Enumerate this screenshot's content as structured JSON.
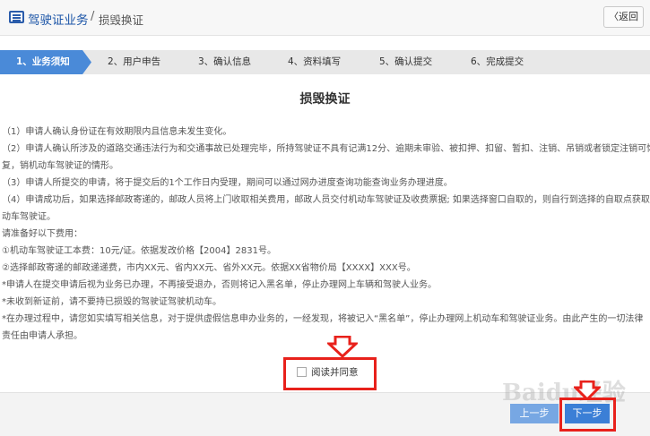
{
  "header": {
    "title": "驾驶证业务",
    "separator": "/",
    "breadcrumb": "损毁换证",
    "back_label": "〈返回"
  },
  "steps": [
    {
      "label": "1、业务须知",
      "active": true
    },
    {
      "label": "2、用户申告",
      "active": false
    },
    {
      "label": "3、确认信息",
      "active": false
    },
    {
      "label": "4、资料填写",
      "active": false
    },
    {
      "label": "5、确认提交",
      "active": false
    },
    {
      "label": "6、完成提交",
      "active": false
    }
  ],
  "doc": {
    "title": "损毁换证",
    "lines": [
      "（1）申请人确认身份证在有效期限内且信息未发生变化。",
      "（2）申请人确认所涉及的道路交通违法行为和交通事故已处理完毕，所持驾驶证不具有记满12分、逾期未审验、被扣押、扣留、暂扣、注销、吊销或者锁定注销可恢",
      "复，销机动车驾驶证的情形。",
      "（3）申请人所提交的申请，将于提交后的1个工作日内受理，期间可以通过网办进度查询功能查询业务办理进度。",
      "（4）申请成功后，如果选择邮政寄递的，邮政人员将上门收取相关费用，邮政人员交付机动车驾驶证及收费票据; 如果选择窗口自取的，则自行到选择的自取点获取机",
      "动车驾驶证。",
      "请准备好以下费用：",
      "   ①机动车驾驶证工本费：10元/证。依据发改价格【2004】2831号。",
      "   ②选择邮政寄递的邮政递递费，市内XX元、省内XX元、省外XX元。依据XX省物价局【XXXX】XXX号。",
      "*申请人在提交申请后视为业务已办理，不再接受退办，否则将记入黑名单，停止办理网上车辆和驾驶人业务。",
      "*未收到新证前，请不要持已损毁的驾驶证驾驶机动车。",
      "*在办理过程中，请您如实填写相关信息，对于提供虚假信息申办业务的，一经发现，将被记入“黑名单”，停止办理网上机动车和驾驶证业务。由此产生的一切法律",
      "责任由申请人承担。"
    ]
  },
  "agree": {
    "label": "阅读并同意",
    "checked": false
  },
  "footer": {
    "prev_label": "上一步",
    "next_label": "下一步"
  },
  "watermark": "Baidu经验",
  "colors": {
    "brand_blue": "#2a5cab",
    "step_active": "#4a8ad8",
    "highlight_red": "#e8211b",
    "btn_next": "#3b7fd6"
  }
}
